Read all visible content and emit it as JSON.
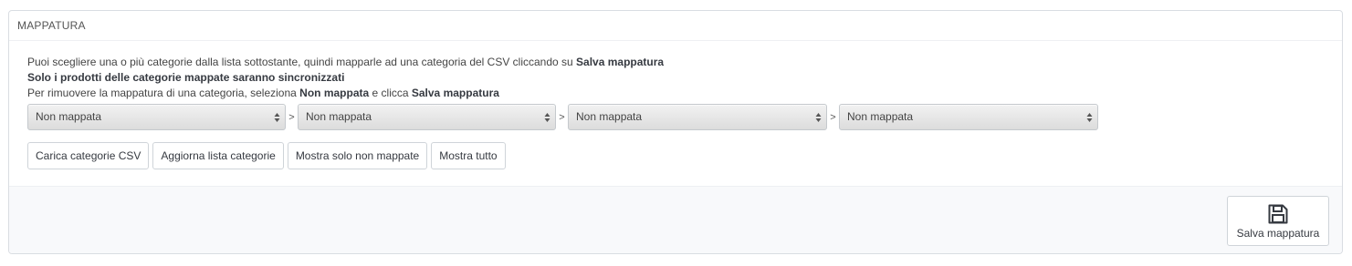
{
  "panel": {
    "title": "MAPPATURA"
  },
  "description": {
    "line1_text": "Puoi scegliere una o più categorie dalla lista sottostante, quindi mapparle ad una categoria del CSV cliccando su ",
    "line1_bold": "Salva mappatura",
    "line2_bold": "Solo i prodotti delle categorie mappate saranno sincronizzati",
    "line3_text_a": "Per rimuovere la mappatura di una categoria, seleziona ",
    "line3_bold_a": "Non mappata",
    "line3_text_b": " e clicca ",
    "line3_bold_b": "Salva mappatura"
  },
  "selects": [
    {
      "value": "Non mappata"
    },
    {
      "value": "Non mappata"
    },
    {
      "value": "Non mappata"
    },
    {
      "value": "Non mappata"
    }
  ],
  "separator": ">",
  "buttons": {
    "load_csv": "Carica categorie CSV",
    "refresh_list": "Aggiorna lista categorie",
    "show_unmapped": "Mostra solo non mappate",
    "show_all": "Mostra tutto"
  },
  "footer": {
    "save_label": "Salva mappatura",
    "save_icon": "floppy-disk-icon"
  }
}
